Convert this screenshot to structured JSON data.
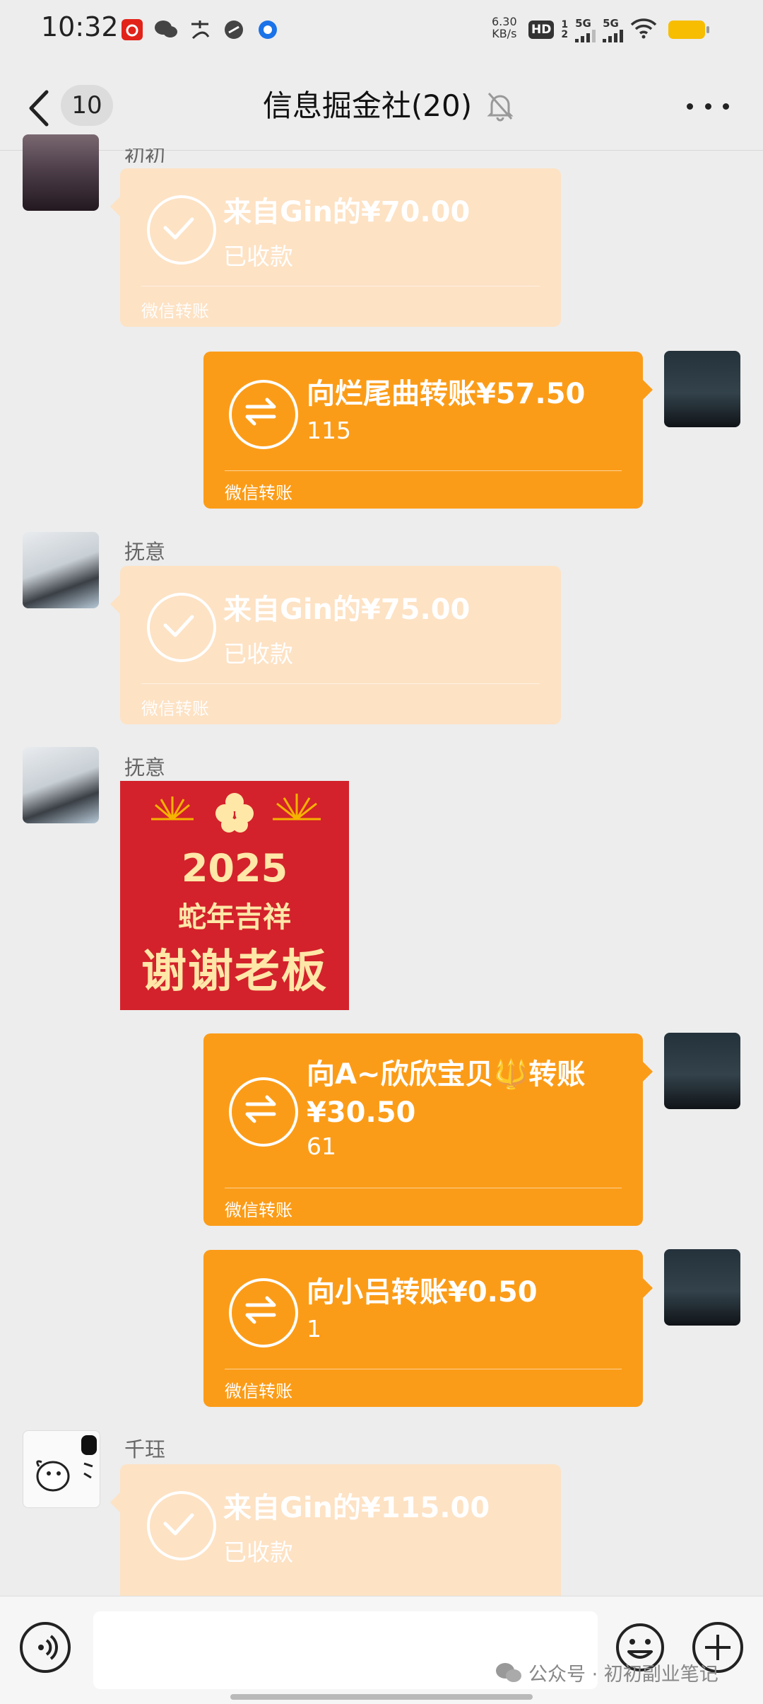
{
  "status_bar": {
    "time": "10:32",
    "notification_icons": [
      "netease-music-icon",
      "wechat-icon",
      "alipay-icon",
      "link-icon",
      "browser-icon"
    ],
    "net_speed_value": "6.30",
    "net_speed_unit": "KB/s",
    "hd_label": "HD",
    "hd_sub_top": "1",
    "hd_sub_bottom": "2",
    "signal1_label": "5G",
    "signal2_label": "5G",
    "battery_color": "#f7bd00"
  },
  "header": {
    "unread_count": "10",
    "title": "信息掘金社(20)"
  },
  "messages": [
    {
      "sender": "初初",
      "type": "transfer_received",
      "title": "来自Gin的¥70.00",
      "status": "已收款",
      "footer": "微信转账"
    },
    {
      "sender": "me",
      "type": "transfer_sent",
      "title": "向烂尾曲转账¥57.50",
      "sub": "115",
      "footer": "微信转账"
    },
    {
      "sender": "抚意",
      "type": "transfer_received",
      "title": "来自Gin的¥75.00",
      "status": "已收款",
      "footer": "微信转账"
    },
    {
      "sender": "抚意",
      "type": "sticker",
      "sticker_year": "2025",
      "sticker_line2": "蛇年吉祥",
      "sticker_line3": "谢谢老板"
    },
    {
      "sender": "me",
      "type": "transfer_sent",
      "title_line1": "向A~欣欣宝贝",
      "title_emoji": "🔱",
      "title_line1_end": "转账",
      "title_line2": "¥30.50",
      "sub": "61",
      "footer": "微信转账"
    },
    {
      "sender": "me",
      "type": "transfer_sent",
      "title": "向小吕转账¥0.50",
      "sub": "1",
      "footer": "微信转账"
    },
    {
      "sender": "千珏",
      "type": "transfer_received",
      "title": "来自Gin的¥115.00",
      "status": "已收款"
    }
  ],
  "watermark": "公众号 · 初初副业笔记",
  "colors": {
    "background": "#ededed",
    "received_card": "#fde2c4",
    "sent_card": "#fb9c18",
    "sticker_bg": "#d3222b"
  }
}
